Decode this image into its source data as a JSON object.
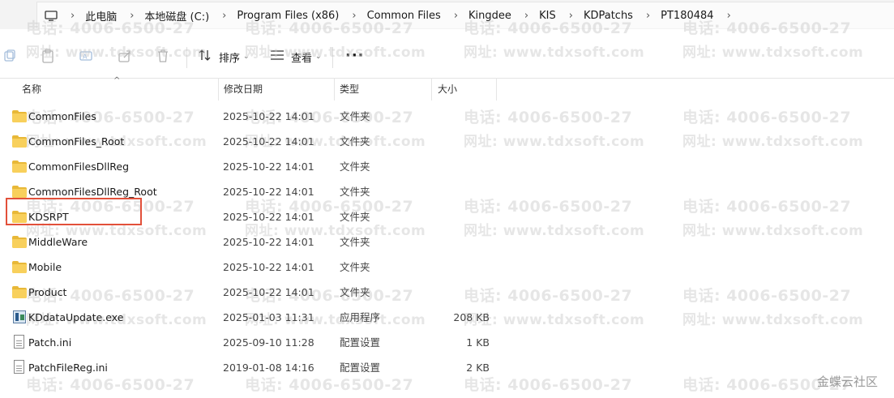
{
  "address": {
    "crumbs": [
      "此电脑",
      "本地磁盘 (C:)",
      "Program Files (x86)",
      "Common Files",
      "Kingdee",
      "KIS",
      "KDPatchs",
      "PT180484"
    ]
  },
  "toolbar": {
    "sort_label": "排序",
    "view_label": "查看",
    "more_label": "···"
  },
  "columns": {
    "name": "名称",
    "date": "修改日期",
    "type": "类型",
    "size": "大小"
  },
  "files": [
    {
      "name": "CommonFiles",
      "date": "2025-10-22 14:01",
      "type": "文件夹",
      "size": "",
      "kind": "folder"
    },
    {
      "name": "CommonFiles_Root",
      "date": "2025-10-22 14:01",
      "type": "文件夹",
      "size": "",
      "kind": "folder"
    },
    {
      "name": "CommonFilesDllReg",
      "date": "2025-10-22 14:01",
      "type": "文件夹",
      "size": "",
      "kind": "folder"
    },
    {
      "name": "CommonFilesDllReg_Root",
      "date": "2025-10-22 14:01",
      "type": "文件夹",
      "size": "",
      "kind": "folder"
    },
    {
      "name": "KDSRPT",
      "date": "2025-10-22 14:01",
      "type": "文件夹",
      "size": "",
      "kind": "folder"
    },
    {
      "name": "MiddleWare",
      "date": "2025-10-22 14:01",
      "type": "文件夹",
      "size": "",
      "kind": "folder"
    },
    {
      "name": "Mobile",
      "date": "2025-10-22 14:01",
      "type": "文件夹",
      "size": "",
      "kind": "folder"
    },
    {
      "name": "Product",
      "date": "2025-10-22 14:01",
      "type": "文件夹",
      "size": "",
      "kind": "folder"
    },
    {
      "name": "KDdataUpdate.exe",
      "date": "2025-01-03 11:31",
      "type": "应用程序",
      "size": "208 KB",
      "kind": "exe"
    },
    {
      "name": "Patch.ini",
      "date": "2025-09-10 11:28",
      "type": "配置设置",
      "size": "1 KB",
      "kind": "ini"
    },
    {
      "name": "PatchFileReg.ini",
      "date": "2019-01-08 14:16",
      "type": "配置设置",
      "size": "2 KB",
      "kind": "ini"
    }
  ],
  "watermark": {
    "phone": "电话: 4006-6500-27",
    "site": "网址: www.tdxsoft.com"
  },
  "community_label": "金蝶云社区",
  "colors": {
    "highlight": "#e2503a",
    "folder": "#f8d05c"
  }
}
